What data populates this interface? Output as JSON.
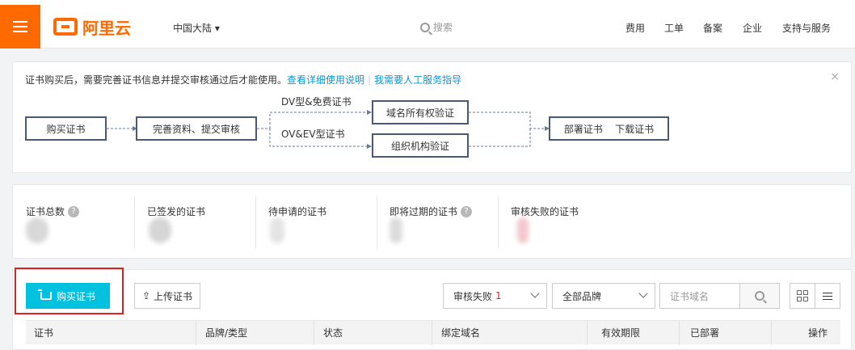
{
  "header": {
    "logo_text": "阿里云",
    "region": "中国大陆 ▾",
    "search_placeholder": "搜索",
    "nav": [
      "费用",
      "工单",
      "备案",
      "企业",
      "支持与服务"
    ],
    "brand_color": "#ff6a00"
  },
  "notice": {
    "text": "证书购买后，需要完善证书信息并提交审核通过后才能使用。",
    "link1": "查看详细使用说明",
    "separator": "|",
    "link2": "我需要人工服务指导",
    "close": "×",
    "flow": {
      "buy": "购买证书",
      "complete": "完善资料、提交审核",
      "dv_label": "DV型&免费证书",
      "ovev_label": "OV&EV型证书",
      "domain_verify": "域名所有权验证",
      "org_verify": "组织机构验证",
      "deploy": "部署证书    下载证书"
    }
  },
  "stats": [
    {
      "label": "证书总数",
      "has_help": true
    },
    {
      "label": "已签发的证书",
      "has_help": false
    },
    {
      "label": "待申请的证书",
      "has_help": false
    },
    {
      "label": "即将过期的证书",
      "has_help": true
    },
    {
      "label": "审核失败的证书",
      "has_help": false
    }
  ],
  "toolbar": {
    "buy_label": "购买证书",
    "upload_label": "上传证书",
    "status_select": "审核失败",
    "status_count": "1",
    "brand_select": "全部品牌",
    "domain_placeholder": "证书域名",
    "accent_color": "#00c1de"
  },
  "table": {
    "columns": [
      "证书",
      "品牌/类型",
      "状态",
      "绑定域名",
      "有效期限",
      "已部署",
      "操作"
    ]
  }
}
